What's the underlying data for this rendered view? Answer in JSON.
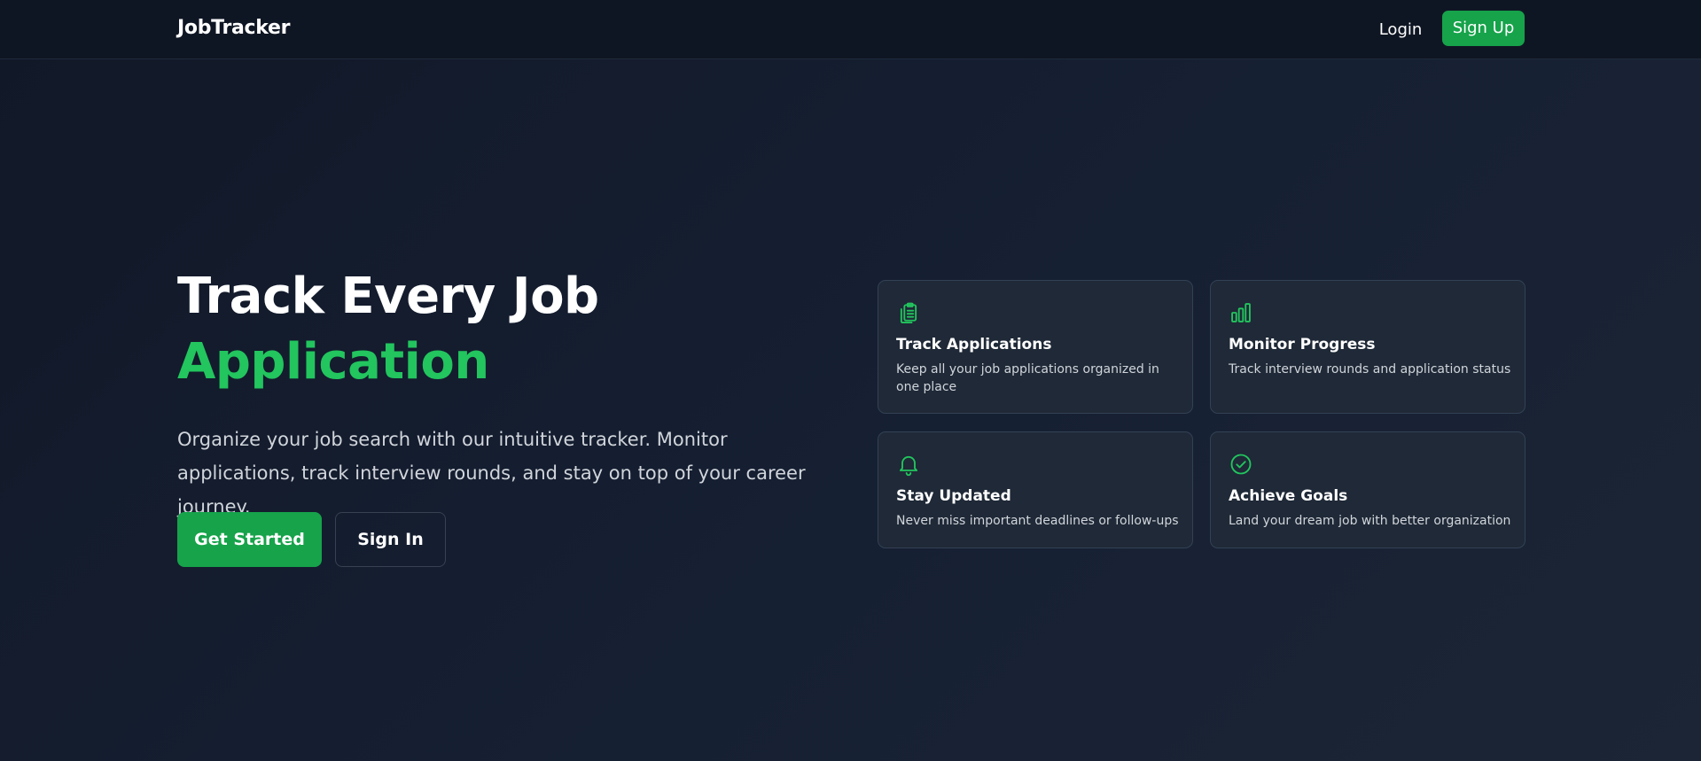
{
  "nav": {
    "brand": "JobTracker",
    "login": "Login",
    "signup": "Sign Up"
  },
  "hero": {
    "title_line1": "Track Every Job",
    "title_line2": "Application",
    "subtitle": "Organize your job search with our intuitive tracker. Monitor applications, track interview rounds, and stay on top of your career journey.",
    "primary_cta": "Get Started",
    "secondary_cta": "Sign In"
  },
  "features": [
    {
      "icon": "clipboard-icon",
      "title": "Track Applications",
      "description": "Keep all your job applications organized in one place"
    },
    {
      "icon": "bar-chart-icon",
      "title": "Monitor Progress",
      "description": "Track interview rounds and application status"
    },
    {
      "icon": "bell-icon",
      "title": "Stay Updated",
      "description": "Never miss important deadlines or follow-ups"
    },
    {
      "icon": "check-circle-icon",
      "title": "Achieve Goals",
      "description": "Land your dream job with better organization"
    }
  ],
  "colors": {
    "background": "#111827",
    "navbar": "#0f1623",
    "accent": "#16a34a",
    "accent_text": "#22c55e",
    "card_bg": "#1f2937",
    "card_border": "#334155"
  }
}
